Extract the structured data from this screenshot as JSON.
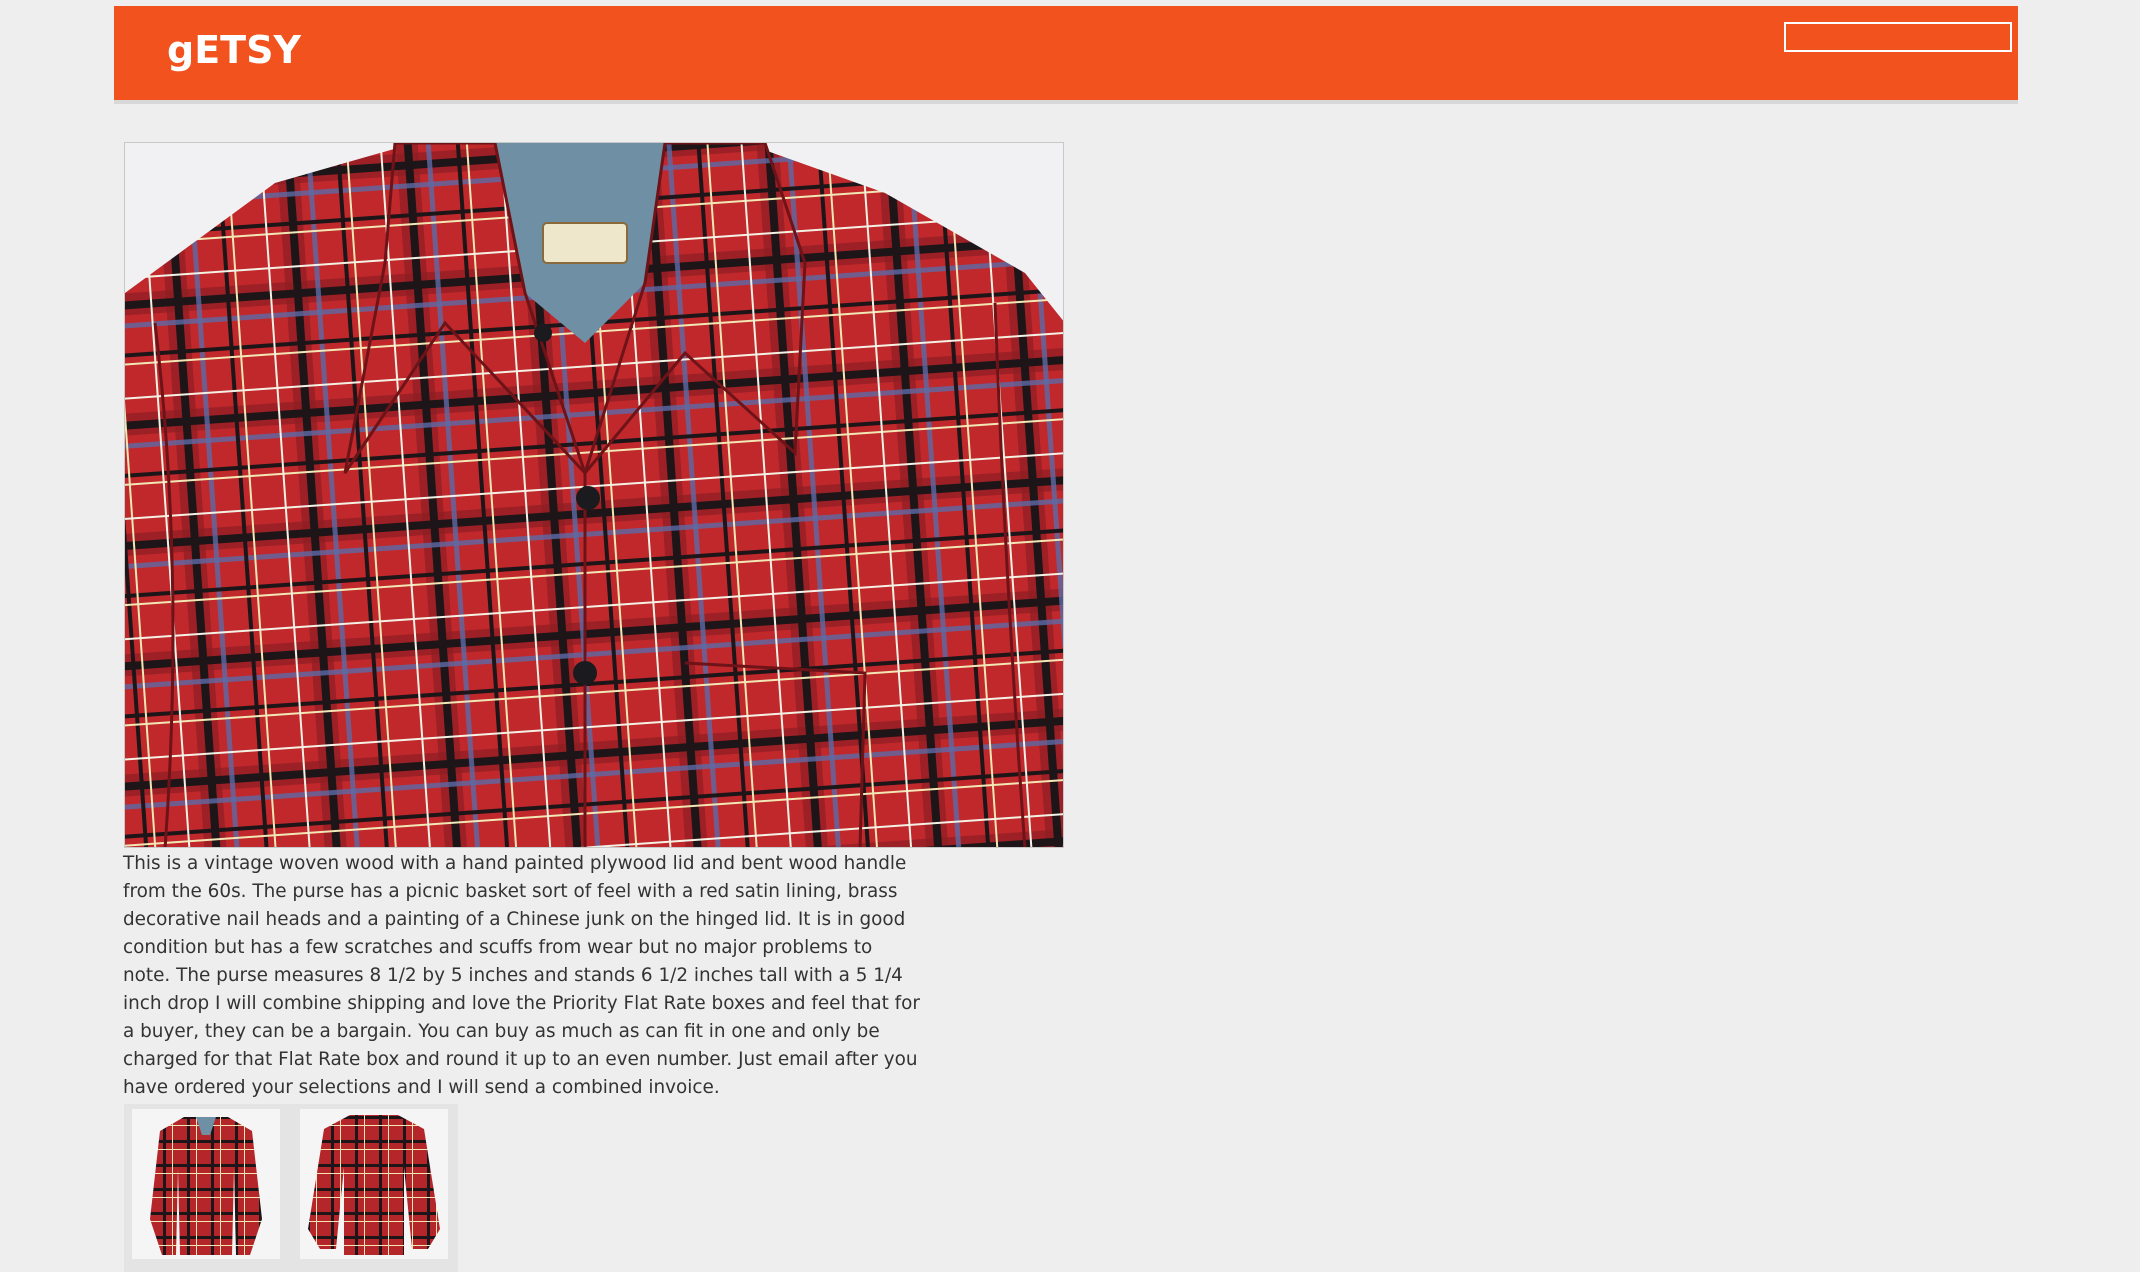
{
  "header": {
    "logo_text": "gETSY",
    "search": {
      "value": "",
      "placeholder": ""
    },
    "background_color": "#f2521d"
  },
  "listing": {
    "main_image": {
      "alt": "Red plaid flannel shirt on a hanger"
    },
    "description": "This is a vintage woven wood with a hand painted plywood lid and bent wood handle from the 60s. The purse has a picnic basket sort of feel with a red satin lining, brass decorative nail heads and a painting of a Chinese junk on the hinged lid. It is in good condition but has a few scratches and scuffs from wear but no major problems to note. The purse measures 8 1/2 by 5 inches and stands 6 1/2 inches tall with a 5 1/4 inch drop I will combine shipping and love the Priority Flat Rate boxes and feel that for a buyer, they can be a bargain. You can buy as much as can fit in one and only be charged for that Flat Rate box and round it up to an even number. Just email after you have ordered your selections and I will send a combined invoice.",
    "thumbnails": [
      {
        "alt": "Plaid shirt front view"
      },
      {
        "alt": "Plaid shirt back view"
      }
    ]
  }
}
